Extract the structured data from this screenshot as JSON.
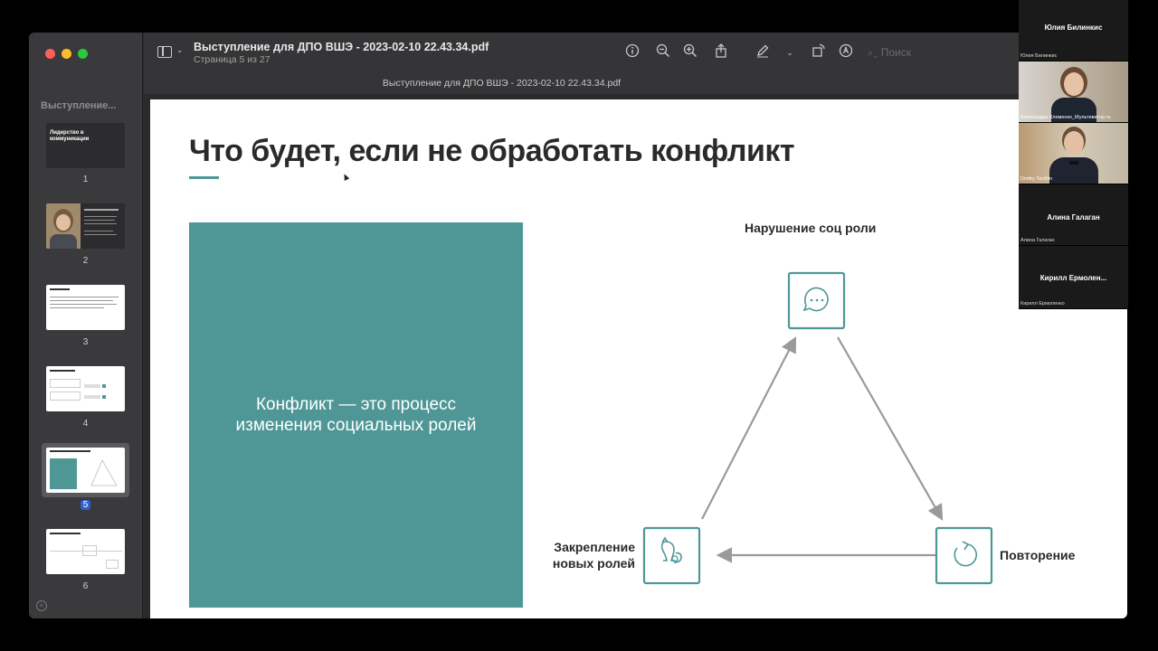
{
  "app": {
    "document_title": "Выступление для ДПО ВШЭ - 2023-02-10 22.43.34.pdf",
    "page_indicator": "Страница 5 из 27",
    "window_subtitle": "Выступление для ДПО ВШЭ - 2023-02-10 22.43.34.pdf",
    "search_placeholder": "Поиск"
  },
  "sidebar": {
    "title": "Выступление...",
    "thumbnails": [
      {
        "number": "1",
        "text": "Лидерство в коммуникации"
      },
      {
        "number": "2"
      },
      {
        "number": "3"
      },
      {
        "number": "4"
      },
      {
        "number": "5",
        "selected": true
      },
      {
        "number": "6"
      }
    ]
  },
  "slide": {
    "title": "Что будет, если не обработать конфликт",
    "box_text_line1": "Конфликт — это процесс",
    "box_text_line2": "изменения социальных ролей",
    "accent_color": "#4f9797",
    "nodes": {
      "top": "Нарушение соц роли",
      "right": "Повторение",
      "left_line1": "Закрепление",
      "left_line2": "новых ролей"
    }
  },
  "participants": [
    {
      "name_heading": "Юлия Билинкис",
      "name_small": "Юлия Билинкис",
      "video": false
    },
    {
      "name_small": "Александра Клименко_Мультивитор.ru",
      "video": true
    },
    {
      "name_small": "Dmitry Torshin",
      "video": true
    },
    {
      "name_heading": "Алина Галаган",
      "name_small": "Алина Галаган",
      "video": false
    },
    {
      "name_heading": "Кирилл  Ермолен...",
      "name_small": "Кирилл Ермоленко",
      "video": false
    }
  ]
}
